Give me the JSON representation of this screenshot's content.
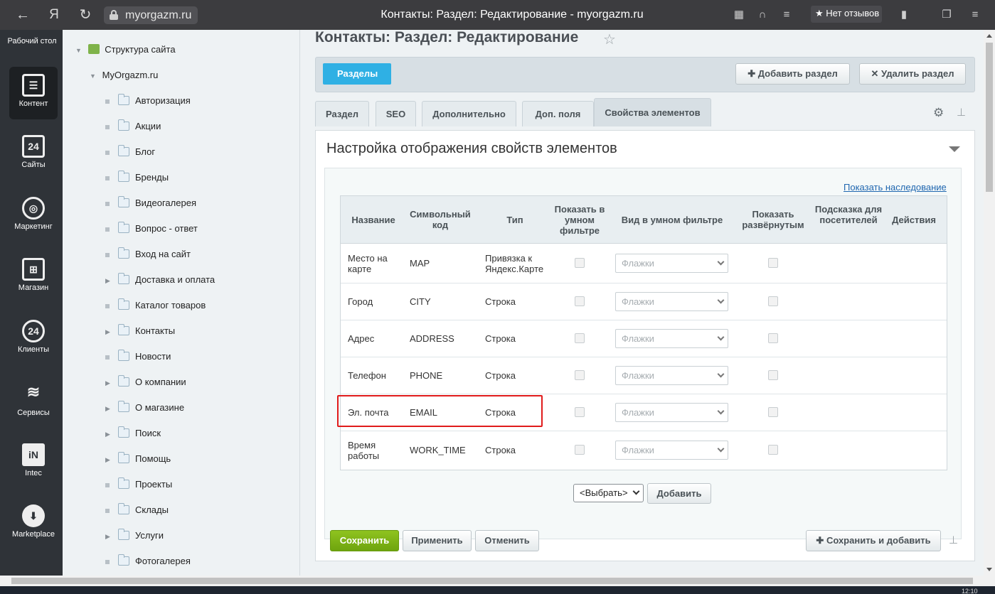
{
  "browser": {
    "back_icon": "arrow-left-icon",
    "yandex_logo": "Я",
    "url": "myorgazm.ru",
    "title": "Контакты: Раздел: Редактирование - myorgazm.ru",
    "reviews": "★ Нет отзывов"
  },
  "rail": {
    "top_label": "Рабочий стол",
    "items": [
      {
        "label": "Контент",
        "icon": "document-icon",
        "glyph": "☰"
      },
      {
        "label": "Сайты",
        "icon": "calendar-24-icon",
        "glyph": "24"
      },
      {
        "label": "Маркетинг",
        "icon": "target-icon",
        "glyph": "◎"
      },
      {
        "label": "Магазин",
        "icon": "basket-icon",
        "glyph": "⊞"
      },
      {
        "label": "Клиенты",
        "icon": "clients-24-icon",
        "glyph": "24"
      },
      {
        "label": "Сервисы",
        "icon": "layers-icon",
        "glyph": "≋"
      },
      {
        "label": "Intec",
        "icon": "intec-logo-icon",
        "glyph": "iN"
      },
      {
        "label": "Marketplace",
        "icon": "cloud-download-icon",
        "glyph": "⬇"
      }
    ]
  },
  "tree": {
    "root": "Структура сайта",
    "site": "MyOrgazm.ru",
    "items": [
      {
        "label": "Авторизация",
        "expandable": false
      },
      {
        "label": "Акции",
        "expandable": false
      },
      {
        "label": "Блог",
        "expandable": false
      },
      {
        "label": "Бренды",
        "expandable": false
      },
      {
        "label": "Видеогалерея",
        "expandable": false
      },
      {
        "label": "Вопрос - ответ",
        "expandable": false
      },
      {
        "label": "Вход на сайт",
        "expandable": false
      },
      {
        "label": "Доставка и оплата",
        "expandable": true
      },
      {
        "label": "Каталог товаров",
        "expandable": false
      },
      {
        "label": "Контакты",
        "expandable": true
      },
      {
        "label": "Новости",
        "expandable": false
      },
      {
        "label": "О компании",
        "expandable": true
      },
      {
        "label": "О магазине",
        "expandable": true
      },
      {
        "label": "Поиск",
        "expandable": true
      },
      {
        "label": "Помощь",
        "expandable": true
      },
      {
        "label": "Проекты",
        "expandable": false
      },
      {
        "label": "Склады",
        "expandable": false
      },
      {
        "label": "Услуги",
        "expandable": true
      },
      {
        "label": "Фотогалерея",
        "expandable": false
      }
    ]
  },
  "page": {
    "title": "Контакты: Раздел: Редактирование",
    "sections_chip": "Разделы",
    "add_section": "Добавить раздел",
    "delete_section": "Удалить раздел",
    "tabs": [
      "Раздел",
      "SEO",
      "Дополнительно",
      "Доп. поля",
      "Свойства элементов"
    ],
    "active_tab": "Свойства элементов",
    "panel_title": "Настройка отображения свойств элементов",
    "show_inheritance": "Показать наследование"
  },
  "table": {
    "headers": [
      "Название",
      "Символьный код",
      "Тип",
      "Показать в умном фильтре",
      "Вид в умном фильтре",
      "Показать развёрнутым",
      "Подсказка для посетителей",
      "Действия"
    ],
    "rows": [
      {
        "name": "Место на карте",
        "code": "MAP",
        "type": "Привязка к Яндекс.Карте",
        "filter_view": "Флажки"
      },
      {
        "name": "Город",
        "code": "CITY",
        "type": "Строка",
        "filter_view": "Флажки"
      },
      {
        "name": "Адрес",
        "code": "ADDRESS",
        "type": "Строка",
        "filter_view": "Флажки"
      },
      {
        "name": "Телефон",
        "code": "PHONE",
        "type": "Строка",
        "filter_view": "Флажки"
      },
      {
        "name": "Эл. почта",
        "code": "EMAIL",
        "type": "Строка",
        "filter_view": "Флажки"
      },
      {
        "name": "Время работы",
        "code": "WORK_TIME",
        "type": "Строка",
        "filter_view": "Флажки"
      }
    ],
    "select_placeholder": "<Выбрать>",
    "add_button": "Добавить"
  },
  "footer": {
    "save": "Сохранить",
    "apply": "Применить",
    "cancel": "Отменить",
    "save_and_add": "Сохранить и добавить"
  },
  "taskbar": {
    "time": "12:10"
  }
}
